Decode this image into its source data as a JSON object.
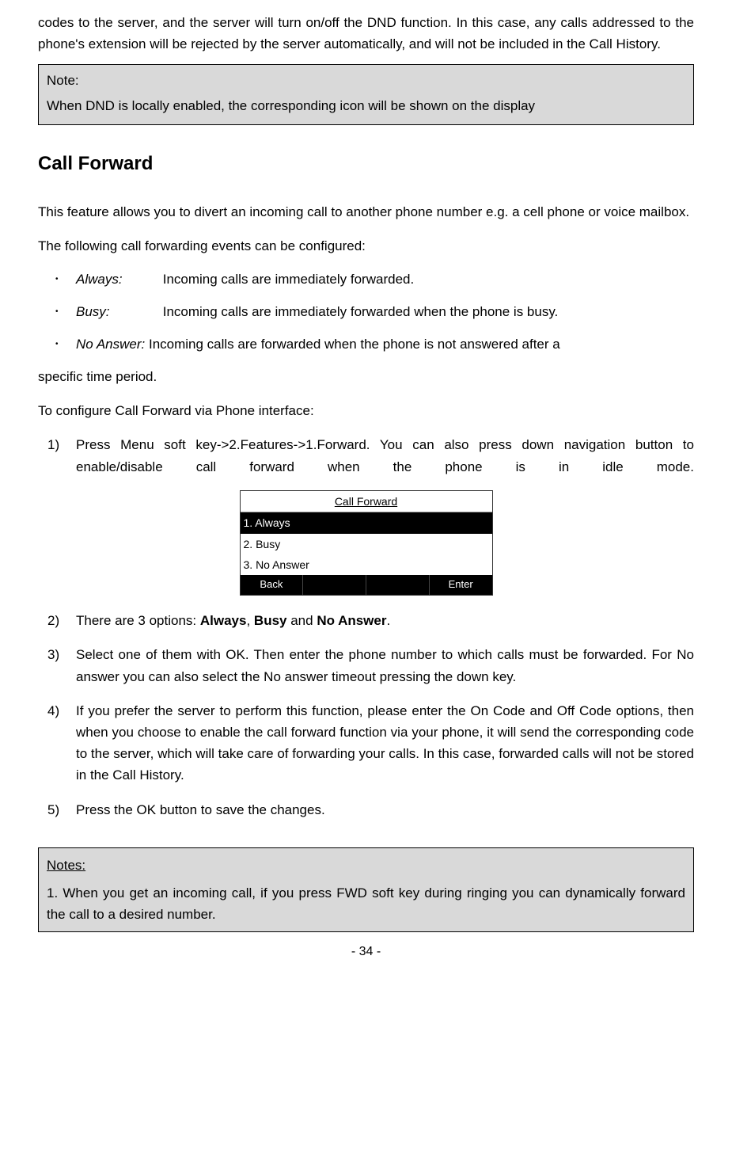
{
  "continuation": "codes to the server, and the server will turn on/off the DND function. In this case, any calls addressed to the phone's extension will be rejected by the server automatically, and will not be included in the Call History.",
  "noteBox": {
    "label": "Note:",
    "text": "When DND is locally enabled, the corresponding icon will be shown on the display"
  },
  "heading": "Call Forward",
  "intro": "This feature allows you to divert an incoming call to another phone number e.g. a cell phone or voice mailbox.",
  "configIntro": "The following call forwarding events can be configured:",
  "bullets": [
    {
      "label": "Always:",
      "desc": "Incoming calls are immediately forwarded."
    },
    {
      "label": "Busy:",
      "desc": "Incoming calls are immediately forwarded when the phone is busy."
    },
    {
      "label": "No Answer:",
      "desc": "Incoming calls are forwarded when the phone is not answered after a"
    }
  ],
  "afterList": "specific time period.",
  "procedureIntro": "To configure Call Forward via Phone interface:",
  "steps": {
    "s1": "Press Menu soft key->2.Features->1.Forward.  You can also press down navigation button to enable/disable call forward when the phone is in idle mode.",
    "s2_pre": "There are 3 options: ",
    "s2_opt1": "Always",
    "s2_sep1": ", ",
    "s2_opt2": "Busy",
    "s2_sep2": " and ",
    "s2_opt3": "No Answer",
    "s2_post": ".",
    "s3": "Select one of them with OK. Then enter the phone number to which calls must be forwarded. For No answer you can also select the No answer timeout pressing the down key.",
    "s4": "If you prefer the server to perform this function, please enter the On Code and Off Code options, then when you choose to enable the call forward function via your phone, it will send the corresponding code to the server, which will take care of forwarding your calls. In this case, forwarded calls will not be stored in the Call History.",
    "s5": "Press the OK button to save the changes."
  },
  "phoneScreen": {
    "title": "Call Forward",
    "row1": "1. Always",
    "row2": "2. Busy",
    "row3": "3. No Answer",
    "btnBack": "Back",
    "btnEnter": "Enter"
  },
  "notesBox": {
    "title": "Notes:",
    "note1": "1. When you get an incoming call, if you press FWD soft key during ringing you can dynamically forward the call to a desired number."
  },
  "pageNumber": "- 34 -"
}
